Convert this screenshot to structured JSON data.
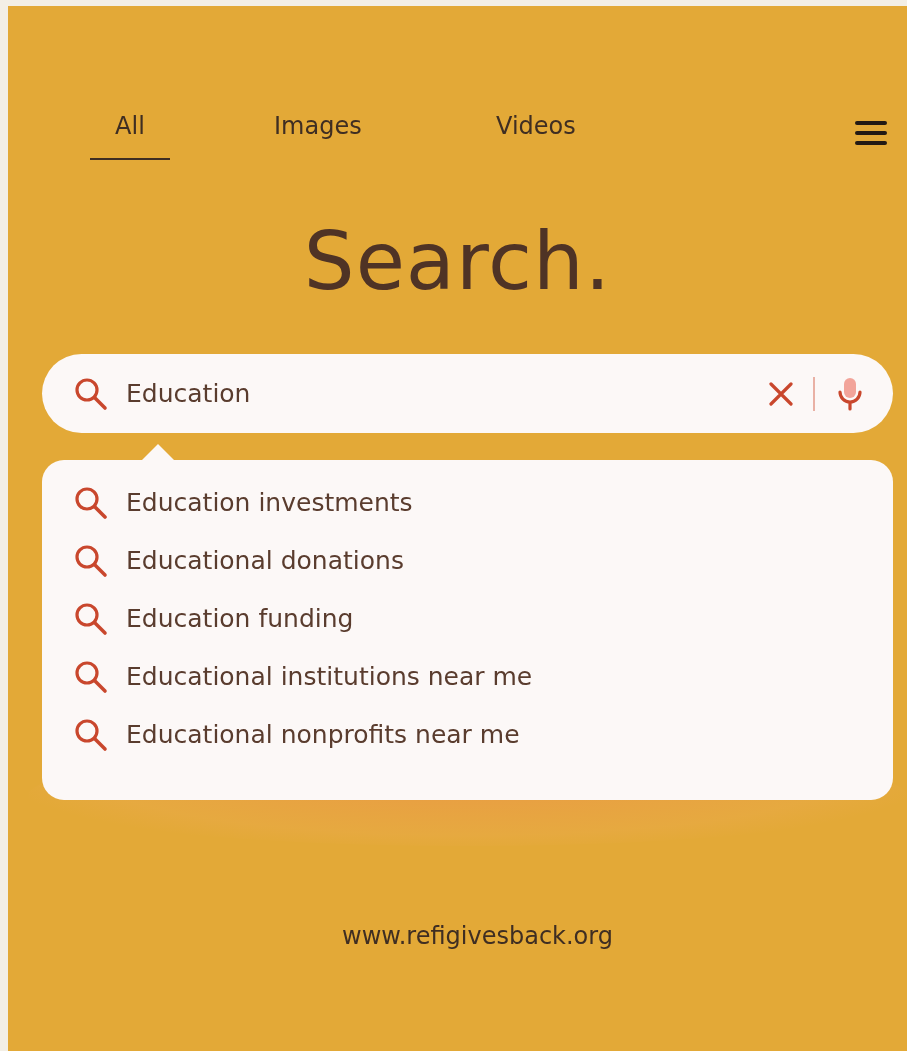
{
  "tabs": [
    {
      "label": "All",
      "selected": true
    },
    {
      "label": "Images",
      "selected": false
    },
    {
      "label": "Videos",
      "selected": false
    }
  ],
  "heading": "Search.",
  "search": {
    "value": "Education"
  },
  "suggestions": [
    "Education investments",
    "Educational donations",
    "Education funding",
    "Educational institutions near me",
    "Educational nonprofits near me"
  ],
  "footer": "www.refigivesback.org"
}
